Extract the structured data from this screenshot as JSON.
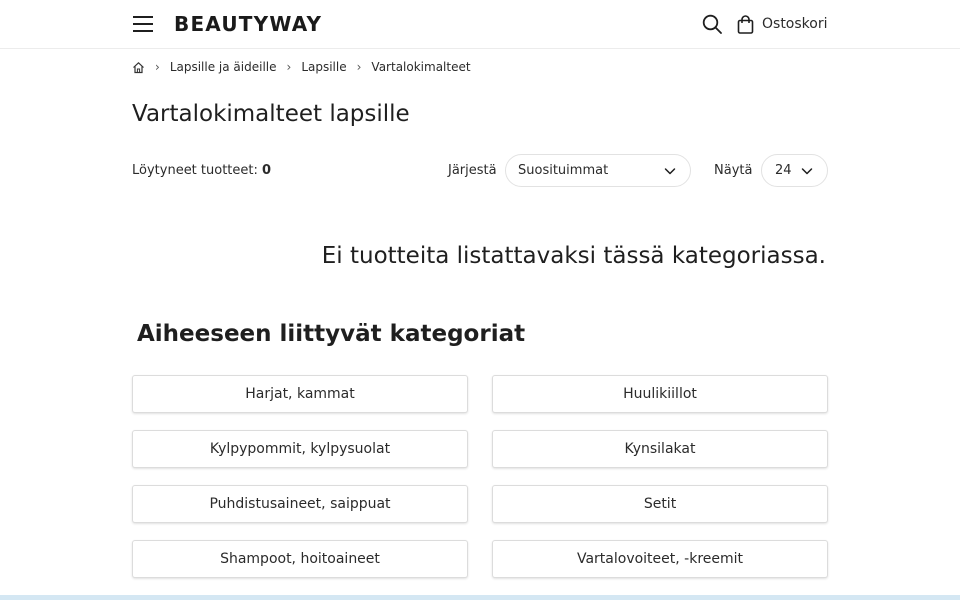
{
  "header": {
    "logo": "BEAUTYWAY",
    "cart_label": "Ostoskori"
  },
  "breadcrumb": {
    "items": [
      "Lapsille ja äideille",
      "Lapsille",
      "Vartalokimalteet"
    ]
  },
  "page": {
    "title": "Vartalokimalteet lapsille",
    "found_label": "Löytyneet tuotteet:",
    "found_count": "0",
    "sort_label": "Järjestä",
    "sort_value": "Suosituimmat",
    "show_label": "Näytä",
    "show_value": "24",
    "empty_message": "Ei tuotteita listattavaksi tässä kategoriassa."
  },
  "related": {
    "title": "Aiheeseen liittyvät kategoriat",
    "categories": [
      "Harjat, kammat",
      "Huulikiillot",
      "Kylpypommit, kylpysuolat",
      "Kynsilakat",
      "Puhdistusaineet, saippuat",
      "Setit",
      "Shampoot, hoitoaineet",
      "Vartalovoiteet, -kreemit"
    ]
  },
  "icons": {
    "menu": "hamburger-menu-icon",
    "search": "search-icon",
    "cart": "shopping-bag-icon",
    "home": "home-icon",
    "chevron": "chevron-down-icon"
  },
  "colors": {
    "text": "#1f1f1f",
    "border": "#dcdcdc",
    "bottom_strip": "#d4e7f3"
  }
}
